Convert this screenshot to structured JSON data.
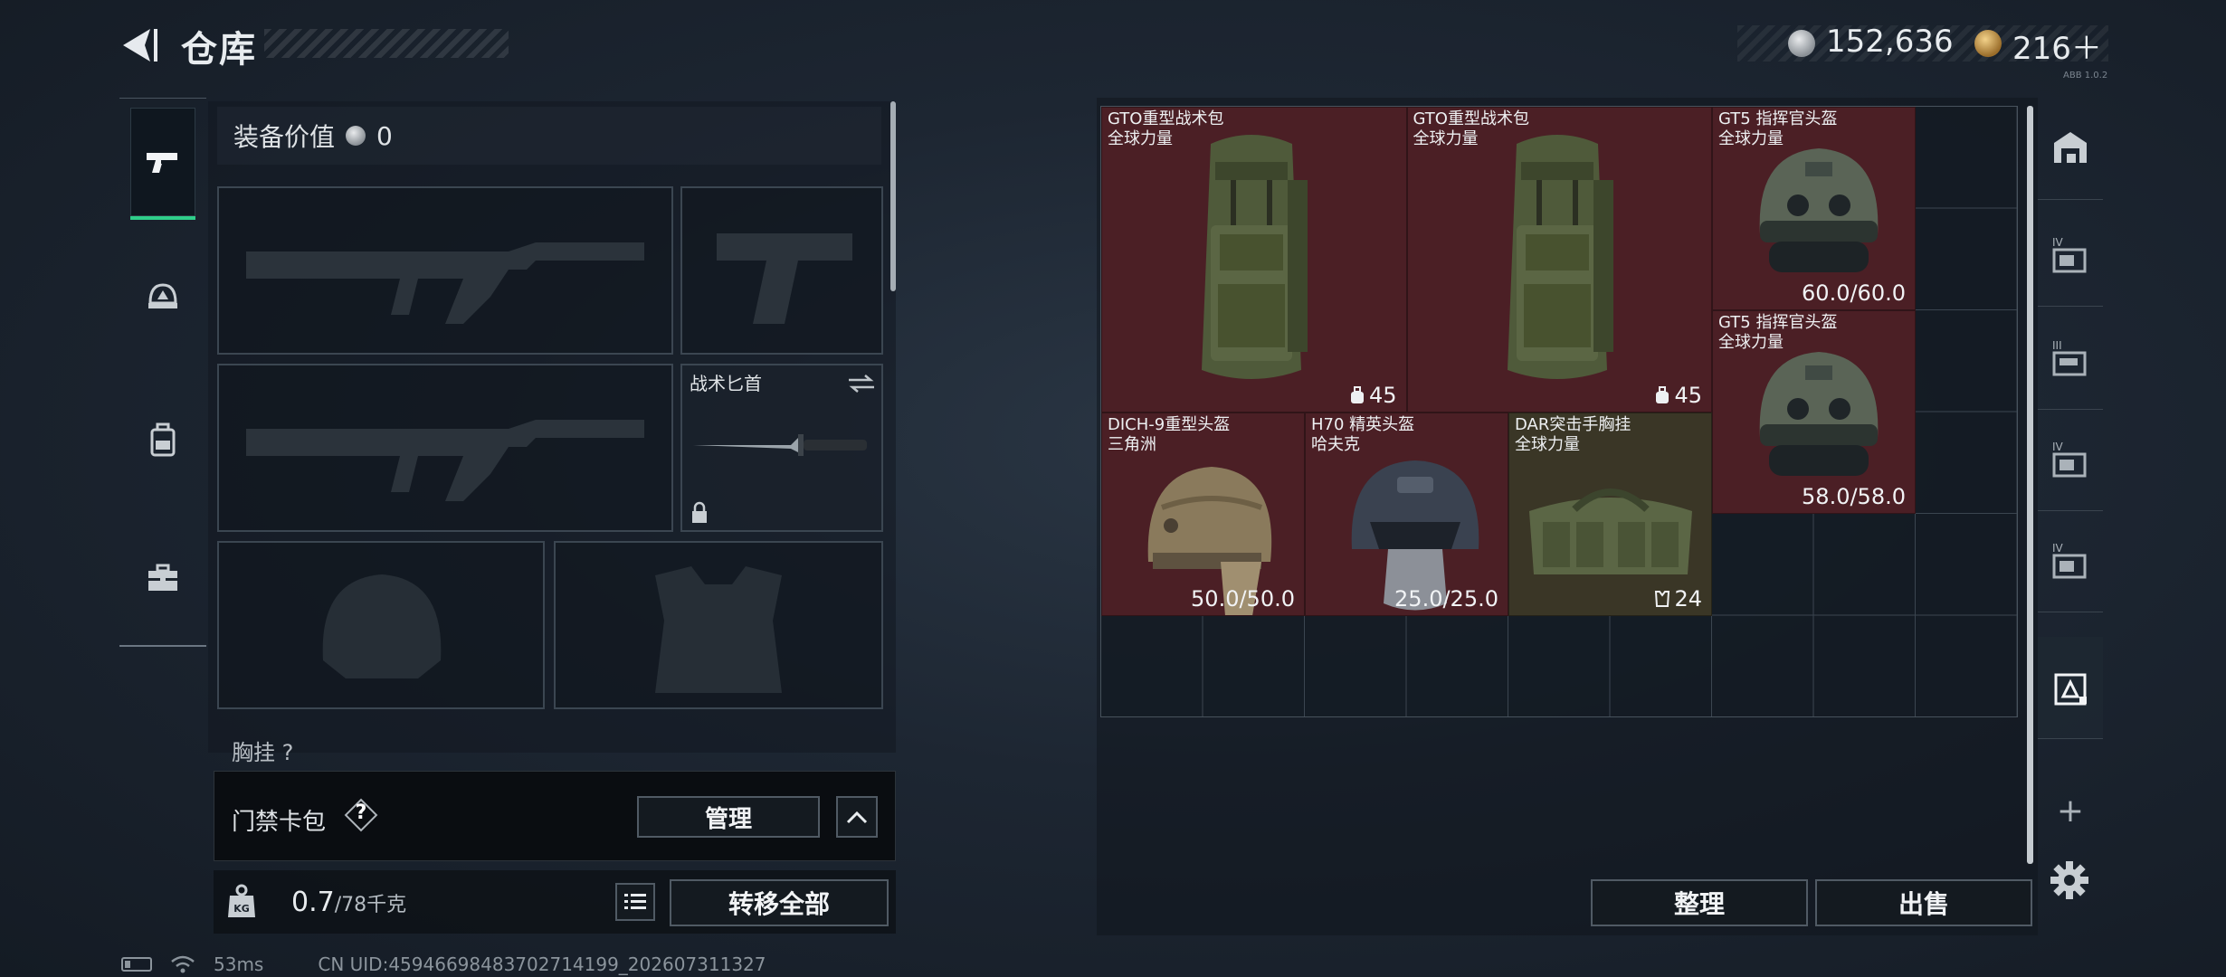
{
  "header": {
    "title": "仓库",
    "currency_silver": "152,636",
    "currency_gold": "216＋",
    "tiny_text": "ABB 1.0.2"
  },
  "left_tabs": [
    {
      "name": "weapon-tab",
      "icon": "pistol-icon",
      "active": true
    },
    {
      "name": "helmet-tab",
      "icon": "helmet-badge-icon",
      "active": false
    },
    {
      "name": "backpack-tab",
      "icon": "backpack-icon",
      "active": false
    },
    {
      "name": "case-tab",
      "icon": "toolbox-icon",
      "active": false
    }
  ],
  "loadout": {
    "equipment_value_label": "装备价值",
    "equipment_value": "0",
    "knife_label": "战术匕首",
    "chest_rig_label": "胸挂",
    "keycard_label": "门禁卡包",
    "help": "?",
    "manage_button": "管理",
    "weight_current": "0.7",
    "weight_max": "/78千克",
    "weight_icon_label": "KG",
    "transfer_button": "转移全部"
  },
  "stash_items": [
    {
      "name_line1": "GTO重型战术包",
      "name_line2": "全球力量",
      "stat": "45",
      "stat_icon": "backpack-capacity-icon",
      "color": "red",
      "art": "backpack"
    },
    {
      "name_line1": "GTO重型战术包",
      "name_line2": "全球力量",
      "stat": "45",
      "stat_icon": "backpack-capacity-icon",
      "color": "red",
      "art": "backpack"
    },
    {
      "name_line1": "GT5 指挥官头盔",
      "name_line2": "全球力量",
      "stat": "60.0/60.0",
      "color": "red",
      "art": "helmet-nvg"
    },
    {
      "name_line1": "GT5 指挥官头盔",
      "name_line2": "全球力量",
      "stat": "58.0/58.0",
      "color": "red",
      "art": "helmet-nvg"
    },
    {
      "name_line1": "DICH-9重型头盔",
      "name_line2": "三角洲",
      "stat": "50.0/50.0",
      "color": "red",
      "art": "helmet-tan"
    },
    {
      "name_line1": "H70 精英头盔",
      "name_line2": "哈夫克",
      "stat": "25.0/25.0",
      "color": "red",
      "art": "helmet-dark"
    },
    {
      "name_line1": "DAR突击手胸挂",
      "name_line2": "全球力量",
      "stat": "24",
      "stat_icon": "vest-capacity-icon",
      "color": "green",
      "art": "chest-rig"
    }
  ],
  "stash_buttons": {
    "sort": "整理",
    "sell": "出售"
  },
  "right_tabs": [
    {
      "name": "stash-main-tab",
      "icon": "warehouse-icon"
    },
    {
      "name": "stash-iv-tab-1",
      "icon": "stash-iv-icon"
    },
    {
      "name": "stash-iii-tab",
      "icon": "stash-iii-icon"
    },
    {
      "name": "stash-iv-tab-2",
      "icon": "stash-iv-icon"
    },
    {
      "name": "stash-iv-tab-3",
      "icon": "stash-iv-icon"
    },
    {
      "name": "stash-active-tab",
      "icon": "stash-active-icon"
    }
  ],
  "plus": "+",
  "status_bar": {
    "ping": "53ms",
    "uid": "CN UID:4594669848370271419​9_202607311327"
  },
  "colors": {
    "active_tab_accent": "#2fcf8a",
    "item_red": "#4b1f25",
    "item_green": "#3a3626"
  }
}
